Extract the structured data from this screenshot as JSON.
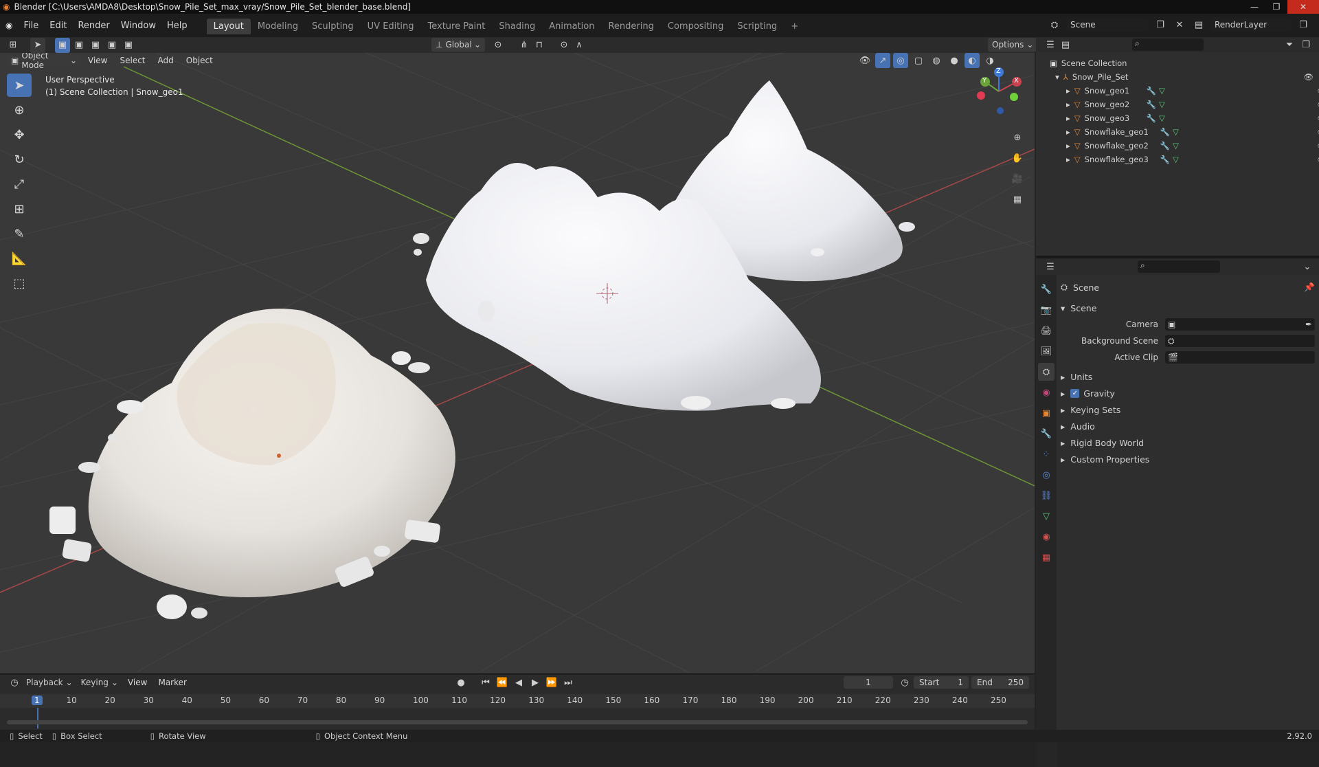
{
  "titlebar": {
    "text": "Blender [C:\\Users\\AMDA8\\Desktop\\Snow_Pile_Set_max_vray/Snow_Pile_Set_blender_base.blend]"
  },
  "menu": {
    "items": [
      "File",
      "Edit",
      "Render",
      "Window",
      "Help"
    ]
  },
  "workspaces": [
    "Layout",
    "Modeling",
    "Sculpting",
    "UV Editing",
    "Texture Paint",
    "Shading",
    "Animation",
    "Rendering",
    "Compositing",
    "Scripting"
  ],
  "scene_selector": {
    "scene": "Scene",
    "render_layer": "RenderLayer"
  },
  "viewport_header": {
    "transform_orientation": "Global",
    "options_label": "Options",
    "mode": "Object Mode",
    "menus": [
      "View",
      "Select",
      "Add",
      "Object"
    ]
  },
  "viewport": {
    "perspective_label": "User Perspective",
    "collection_label": "(1) Scene Collection | Snow_geo1",
    "background_color": "#393939",
    "grid_color": "#454545",
    "x_axis_color": "#b34a4a",
    "y_axis_color": "#78a33a"
  },
  "gizmo": {
    "x": "X",
    "y": "Y",
    "z": "Z"
  },
  "outliner": {
    "root": "Scene Collection",
    "collection": "Snow_Pile_Set",
    "objects": [
      "Snow_geo1",
      "Snow_geo2",
      "Snow_geo3",
      "Snowflake_geo1",
      "Snowflake_geo2",
      "Snowflake_geo3"
    ]
  },
  "properties": {
    "header": "Scene",
    "section": "Scene",
    "fields": [
      {
        "label": "Camera",
        "value": ""
      },
      {
        "label": "Background Scene",
        "value": ""
      },
      {
        "label": "Active Clip",
        "value": ""
      }
    ],
    "panels": [
      {
        "label": "Units",
        "checkbox": false
      },
      {
        "label": "Gravity",
        "checkbox": true
      },
      {
        "label": "Keying Sets",
        "checkbox": false
      },
      {
        "label": "Audio",
        "checkbox": false
      },
      {
        "label": "Rigid Body World",
        "checkbox": false
      },
      {
        "label": "Custom Properties",
        "checkbox": false
      }
    ]
  },
  "timeline": {
    "menus": [
      "Playback",
      "Keying",
      "View",
      "Marker"
    ],
    "current_frame": "1",
    "start_label": "Start",
    "start_value": "1",
    "end_label": "End",
    "end_value": "250",
    "ticks": [
      "1",
      "10",
      "20",
      "30",
      "40",
      "50",
      "60",
      "70",
      "80",
      "90",
      "100",
      "110",
      "120",
      "130",
      "140",
      "150",
      "160",
      "170",
      "180",
      "190",
      "200",
      "210",
      "220",
      "230",
      "240",
      "250"
    ]
  },
  "statusbar": {
    "select": "Select",
    "box_select": "Box Select",
    "rotate_view": "Rotate View",
    "context_menu": "Object Context Menu",
    "version": "2.92.0"
  },
  "colors": {
    "accent": "#4772b3",
    "selected_tab": "#3d3d3d",
    "orange_object": "#e0883a",
    "green_data": "#5fc17a"
  }
}
